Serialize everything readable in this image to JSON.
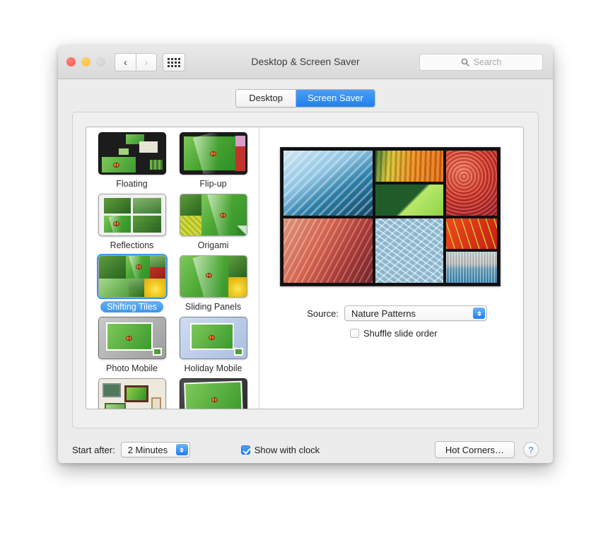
{
  "window": {
    "title": "Desktop & Screen Saver",
    "traffic_lights": [
      "close",
      "minimize",
      "zoom"
    ],
    "nav": {
      "back": "‹",
      "forward": "›"
    },
    "show_all_icon": "grid-icon",
    "search": {
      "placeholder": "Search",
      "value": "",
      "icon": "search-icon"
    }
  },
  "tabs": [
    {
      "label": "Desktop",
      "active": false
    },
    {
      "label": "Screen Saver",
      "active": true
    }
  ],
  "savers": [
    {
      "label": "Floating",
      "selected": false,
      "style": "floating"
    },
    {
      "label": "Flip-up",
      "selected": false,
      "style": "flipup"
    },
    {
      "label": "Reflections",
      "selected": false,
      "style": "reflections"
    },
    {
      "label": "Origami",
      "selected": false,
      "style": "origami"
    },
    {
      "label": "Shifting Tiles",
      "selected": true,
      "style": "shiftingtiles"
    },
    {
      "label": "Sliding Panels",
      "selected": false,
      "style": "slidingpanels"
    },
    {
      "label": "Photo Mobile",
      "selected": false,
      "style": "photomobile"
    },
    {
      "label": "Holiday Mobile",
      "selected": false,
      "style": "holidaymobile"
    },
    {
      "label": "",
      "selected": false,
      "style": "photowall"
    },
    {
      "label": "",
      "selected": false,
      "style": "classic"
    }
  ],
  "preview": {
    "name": "screen-saver-preview",
    "tiles": [
      {
        "name": "iceberg",
        "color": "#6fb2d6"
      },
      {
        "name": "orange-grass",
        "color": "#ef8a16"
      },
      {
        "name": "green-leaf",
        "color": "#2f7a33"
      },
      {
        "name": "autumn-forest",
        "color": "#e03a2a"
      },
      {
        "name": "sandstone",
        "color": "#e8705a"
      },
      {
        "name": "frost",
        "color": "#8ab6cf"
      },
      {
        "name": "red-leaf",
        "color": "#e8401c"
      },
      {
        "name": "reeds",
        "color": "#6fa8c4"
      }
    ]
  },
  "options": {
    "source_label": "Source:",
    "source_value": "Nature Patterns",
    "shuffle_label": "Shuffle slide order",
    "shuffle_checked": false
  },
  "bottom": {
    "start_after_label": "Start after:",
    "start_after_value": "2 Minutes",
    "show_with_clock_label": "Show with clock",
    "show_with_clock_checked": true,
    "hot_corners_label": "Hot Corners…",
    "help_label": "?"
  },
  "colors": {
    "accent": "#1f7fef",
    "selected_pill": "#3e96ea",
    "window_bg": "#ececec"
  }
}
